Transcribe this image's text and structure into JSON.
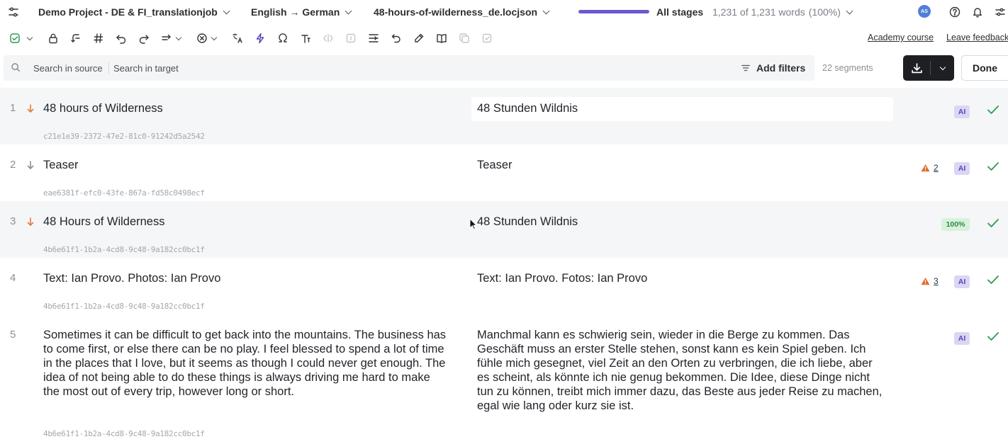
{
  "header": {
    "project": "Demo Project - DE & FI_translationjob",
    "language_pair": "English → German",
    "file": "48-hours-of-wilderness_de.locjson",
    "stage_progress": 1.0,
    "stage": "All stages",
    "word_count": "1,231 of 1,231 words",
    "word_pct": "(100%)",
    "avatar_initials": "AS"
  },
  "links": {
    "academy": "Academy course",
    "feedback": "Leave feedback"
  },
  "filters": {
    "search_source_placeholder": "Search in source",
    "search_target_placeholder": "Search in target",
    "add_filters": "Add filters",
    "segment_count": "22 segments",
    "done": "Done"
  },
  "segments": [
    {
      "num": "1",
      "source": "48 hours of Wilderness",
      "target": "48 Stunden Wildnis",
      "key": "c21e1e39-2372-47e2-81c0-91242d5a2542",
      "badge": "AI",
      "warnings": "",
      "confirmed": true
    },
    {
      "num": "2",
      "source": "Teaser",
      "target": "Teaser",
      "key": "eae6381f-efc0-43fe-867a-fd58c0498ecf",
      "badge": "AI",
      "warnings": "2",
      "confirmed": true
    },
    {
      "num": "3",
      "source": "48 Hours of Wilderness",
      "target": "48 Stunden Wildnis",
      "key": "4b6e61f1-1b2a-4cd8-9c48-9a182cc0bc1f",
      "badge": "100%",
      "warnings": "",
      "confirmed": true
    },
    {
      "num": "4",
      "source": "Text: Ian Provo. Photos: Ian Provo",
      "target": "Text: Ian Provo. Fotos: Ian Provo",
      "key": "4b6e61f1-1b2a-4cd8-9c48-9a182cc0bc1f",
      "badge": "AI",
      "warnings": "3",
      "confirmed": true
    },
    {
      "num": "5",
      "source": "Sometimes it can be difficult to get back into the mountains. The business has to come first, or else there can be no play. I feel blessed to spend a lot of time in the places that I love, but it seems as though I could never get enough. The idea of not being able to do these things is always driving me hard to make the most out of every trip, however long or short.",
      "target": "Manchmal kann es schwierig sein, wieder in die Berge zu kommen. Das Geschäft muss an erster Stelle stehen, sonst kann es kein Spiel geben. Ich fühle mich gesegnet, viel Zeit an den Orten zu verbringen, die ich liebe, aber es scheint, als könnte ich nie genug bekommen. Die Idee, diese Dinge nicht tun zu können, treibt mich immer dazu, das Beste aus jeder Reise zu machen, egal wie lang oder kurz sie ist.",
      "key": "4b6e61f1-1b2a-4cd8-9c48-9a182cc0bc1f",
      "badge": "AI",
      "warnings": "",
      "confirmed": true
    }
  ],
  "colors": {
    "accent": "#6e56cf",
    "arrow_orange": "#e07b39",
    "arrow_gray": "#8a8f96",
    "check_green": "#2f9a52",
    "warn_orange": "#e06a2a"
  }
}
